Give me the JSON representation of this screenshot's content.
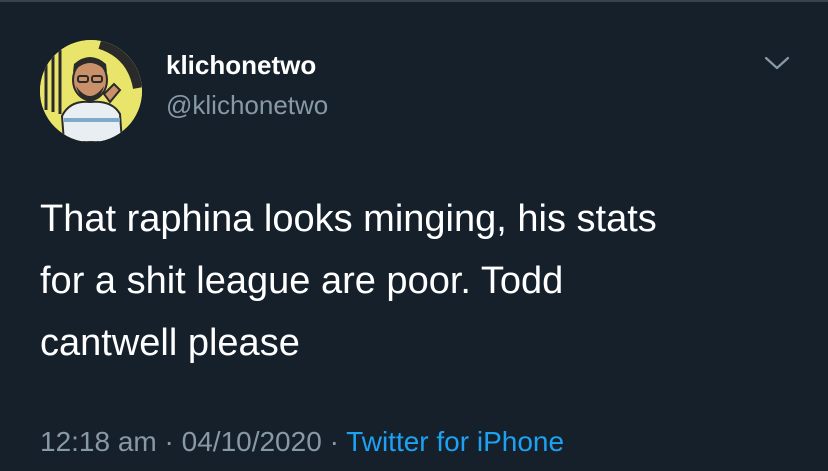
{
  "tweet": {
    "author": {
      "display_name": "klichonetwo",
      "handle": "@klichonetwo",
      "avatar_icon": "profile-avatar"
    },
    "menu_icon": "chevron-down-icon",
    "text": "That raphina looks minging, his stats\nfor a shit league are poor. Todd\ncantwell please",
    "meta": {
      "time": "12:18 am",
      "separator": "·",
      "date": "04/10/2020",
      "source": "Twitter for iPhone"
    }
  },
  "colors": {
    "background": "#15202b",
    "primary_text": "#ffffff",
    "secondary_text": "#8899a6",
    "link": "#1da1f2",
    "avatar_bg": "#e9e46a"
  }
}
